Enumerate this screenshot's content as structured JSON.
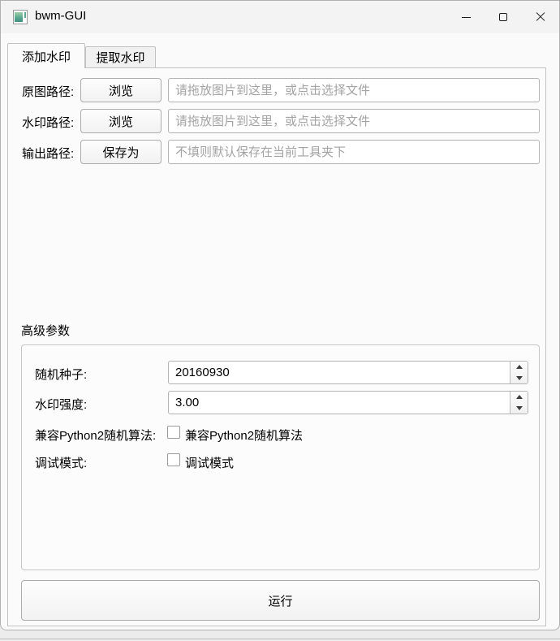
{
  "window": {
    "title": "bwm-GUI",
    "controls": {
      "minimize_icon": "minimize",
      "maximize_icon": "maximize",
      "close_icon": "close"
    }
  },
  "tabs": [
    {
      "label": "添加水印",
      "active": true
    },
    {
      "label": "提取水印",
      "active": false
    }
  ],
  "form": {
    "rows": [
      {
        "label": "原图路径:",
        "button": "浏览",
        "value": "",
        "placeholder": "请拖放图片到这里，或点击选择文件"
      },
      {
        "label": "水印路径:",
        "button": "浏览",
        "value": "",
        "placeholder": "请拖放图片到这里，或点击选择文件"
      },
      {
        "label": "输出路径:",
        "button": "保存为",
        "value": "",
        "placeholder": "不填则默认保存在当前工具夹下"
      }
    ]
  },
  "advanced": {
    "group_label": "高级参数",
    "seed": {
      "label": "随机种子:",
      "value": "20160930"
    },
    "strength": {
      "label": "水印强度:",
      "value": "3.00"
    },
    "python2": {
      "label": "兼容Python2随机算法:",
      "checkbox_label": "兼容Python2随机算法",
      "checked": false
    },
    "debug": {
      "label": "调试模式:",
      "checkbox_label": "调试模式",
      "checked": false
    }
  },
  "run_button_label": "运行",
  "colors": {
    "titlebar_bg": "#f3f3f3",
    "pane_bg": "#fbfbfb",
    "border": "#c2c2c2",
    "placeholder_text": "#a3a3a3",
    "icon_accent": "#5aa98f"
  }
}
